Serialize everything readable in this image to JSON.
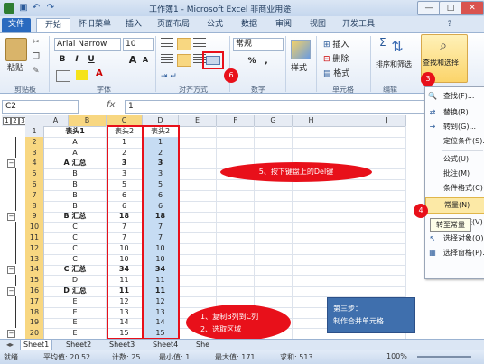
{
  "window": {
    "title": "工作簿1 - Microsoft Excel 非商业用途",
    "controls": [
      "—",
      "□",
      "✕"
    ]
  },
  "ribbon_tabs": [
    "文件",
    "开始",
    "怀旧菜单",
    "插入",
    "页面布局",
    "公式",
    "数据",
    "审阅",
    "视图",
    "开发工具"
  ],
  "ribbon": {
    "paste": "粘贴",
    "font_name": "Arial Narrow",
    "font_size": "10",
    "bold": "B",
    "italic": "I",
    "underline": "U",
    "bigger_font": "A",
    "smaller_font": "A",
    "number_format": "常规",
    "currency": "%",
    "comma": ",",
    "insert": "插入",
    "delete": "删除",
    "format": "格式",
    "style": "样式",
    "sort_filter": "排序和筛选",
    "find_select": "查找和选择",
    "groups": [
      "剪贴板",
      "字体",
      "对齐方式",
      "数字",
      "单元格",
      "编辑"
    ]
  },
  "formula_bar": {
    "name_box": "C2",
    "fx": "fx",
    "value": "1"
  },
  "outline_levels": [
    "1",
    "2",
    "3"
  ],
  "columns": [
    "A",
    "B",
    "C",
    "D",
    "E",
    "F",
    "G",
    "H",
    "I",
    "J"
  ],
  "rows": [
    {
      "n": "1",
      "a": "表头1",
      "b": "表头2",
      "c": "表头2"
    },
    {
      "n": "2",
      "a": "A",
      "b": "1",
      "c": "1"
    },
    {
      "n": "3",
      "a": "A",
      "b": "2",
      "c": "2"
    },
    {
      "n": "4",
      "a": "A 汇总",
      "b": "3",
      "c": "3"
    },
    {
      "n": "5",
      "a": "B",
      "b": "3",
      "c": "3"
    },
    {
      "n": "6",
      "a": "B",
      "b": "5",
      "c": "5"
    },
    {
      "n": "7",
      "a": "B",
      "b": "6",
      "c": "6"
    },
    {
      "n": "8",
      "a": "B",
      "b": "6",
      "c": "6"
    },
    {
      "n": "9",
      "a": "B 汇总",
      "b": "18",
      "c": "18"
    },
    {
      "n": "10",
      "a": "C",
      "b": "7",
      "c": "7"
    },
    {
      "n": "11",
      "a": "C",
      "b": "7",
      "c": "7"
    },
    {
      "n": "12",
      "a": "C",
      "b": "10",
      "c": "10"
    },
    {
      "n": "13",
      "a": "C",
      "b": "10",
      "c": "10"
    },
    {
      "n": "14",
      "a": "C 汇总",
      "b": "34",
      "c": "34"
    },
    {
      "n": "15",
      "a": "D",
      "b": "11",
      "c": "11"
    },
    {
      "n": "16",
      "a": "D 汇总",
      "b": "11",
      "c": "11"
    },
    {
      "n": "17",
      "a": "E",
      "b": "12",
      "c": "12"
    },
    {
      "n": "18",
      "a": "E",
      "b": "13",
      "c": "13"
    },
    {
      "n": "19",
      "a": "E",
      "b": "14",
      "c": "14"
    },
    {
      "n": "20",
      "a": "E",
      "b": "15",
      "c": "15"
    }
  ],
  "sheet_tabs": [
    "Sheet1",
    "Sheet2",
    "Sheet3",
    "Sheet4",
    "She"
  ],
  "status": {
    "ready": "就绪",
    "average": "平均值: 20.52",
    "count": "计数: 25",
    "min": "最小值: 1",
    "max": "最大值: 171",
    "sum": "求和: 513",
    "zoom": "100%"
  },
  "menu": {
    "items": [
      {
        "icon": "🔍",
        "label": "查找(F)..."
      },
      {
        "icon": "⇄",
        "label": "替换(R)..."
      },
      {
        "icon": "→",
        "label": "转到(G)..."
      },
      {
        "icon": "",
        "label": "定位条件(S)..."
      },
      {
        "icon": "",
        "label": "公式(U)"
      },
      {
        "icon": "",
        "label": "批注(M)"
      },
      {
        "icon": "",
        "label": "条件格式(C)"
      },
      {
        "icon": "",
        "label": "常量(N)"
      },
      {
        "icon": "",
        "label": "数据验证(V)"
      },
      {
        "icon": "↖",
        "label": "选择对象(O)"
      },
      {
        "icon": "▦",
        "label": "选择窗格(P)..."
      }
    ],
    "tooltip": "转至常量"
  },
  "annotations": {
    "step5": "5、按下键盘上的Del键",
    "step12_line1": "1、复制B列到C列",
    "step12_line2": "2、选取区域",
    "step3_line1": "第三步：",
    "step3_line2": "制作合并单元格",
    "num3": "3",
    "num4": "4",
    "num6": "6"
  },
  "colors": {
    "annotation_red": "#e8101a",
    "selection_blue": "#c6dcf3",
    "highlight_orange": "#f8d781",
    "note_box_blue": "#3f6fad"
  }
}
